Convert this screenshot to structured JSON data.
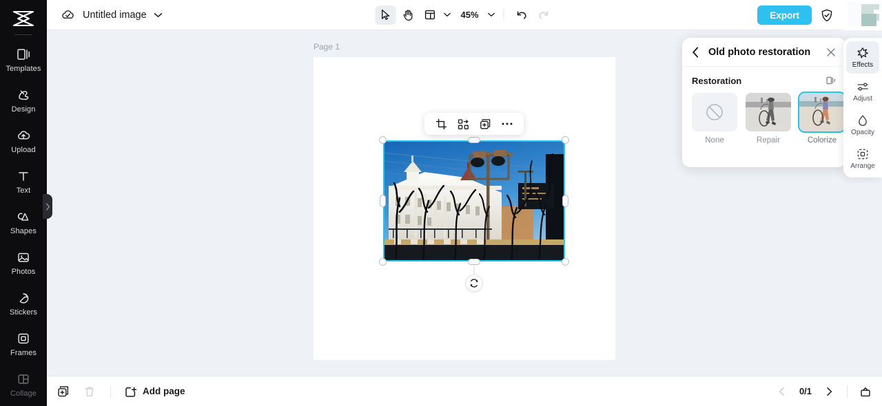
{
  "sidebar": {
    "logo_name": "capcut-logo",
    "items": [
      {
        "label": "Templates",
        "icon": "templates-icon",
        "dim": false
      },
      {
        "label": "Design",
        "icon": "design-icon",
        "dim": false
      },
      {
        "label": "Upload",
        "icon": "upload-icon",
        "dim": false
      },
      {
        "label": "Text",
        "icon": "text-icon",
        "dim": false
      },
      {
        "label": "Shapes",
        "icon": "shapes-icon",
        "dim": false
      },
      {
        "label": "Photos",
        "icon": "photos-icon",
        "dim": false
      },
      {
        "label": "Stickers",
        "icon": "stickers-icon",
        "dim": false
      },
      {
        "label": "Frames",
        "icon": "frames-icon",
        "dim": false
      },
      {
        "label": "Collage",
        "icon": "collage-icon",
        "dim": true
      }
    ]
  },
  "topbar": {
    "cloud_icon": "cloud-sync-icon",
    "title": "Untitled image",
    "title_caret": "chevron-down-icon",
    "tools": [
      {
        "name": "select-tool",
        "icon": "cursor-arrow-icon",
        "active": true
      },
      {
        "name": "hand-tool",
        "icon": "hand-icon",
        "active": false
      },
      {
        "name": "layout-tool",
        "icon": "layout-grid-icon",
        "active": false
      }
    ],
    "zoom_level": "45%",
    "undo_label": "undo-icon",
    "redo_label": "redo-icon",
    "export_label": "Export",
    "shield_icon": "shield-check-icon",
    "avatar": "user-avatar"
  },
  "canvas": {
    "page_label": "Page 1",
    "context_toolbar": [
      {
        "name": "crop-button",
        "icon": "crop-icon"
      },
      {
        "name": "replace-button",
        "icon": "replace-image-icon"
      },
      {
        "name": "duplicate-button",
        "icon": "duplicate-icon"
      },
      {
        "name": "more-button",
        "icon": "ellipsis-icon"
      }
    ],
    "selection_color": "#22c7ef",
    "rotate_handle": "rotate-icon"
  },
  "panel": {
    "back_icon": "chevron-left-icon",
    "title": "Old photo restoration",
    "close_icon": "close-icon",
    "section_title": "Restoration",
    "compare_icon": "before-after-compare-icon",
    "options": [
      {
        "label": "None",
        "selected": false,
        "kind": "none"
      },
      {
        "label": "Repair",
        "selected": false,
        "kind": "grayscale"
      },
      {
        "label": "Colorize",
        "selected": true,
        "kind": "color"
      }
    ]
  },
  "right_rail": {
    "items": [
      {
        "label": "Effects",
        "icon": "sparkle-icon",
        "active": true
      },
      {
        "label": "Adjust",
        "icon": "sliders-icon",
        "active": false
      },
      {
        "label": "Opacity",
        "icon": "droplet-icon",
        "active": false
      },
      {
        "label": "Arrange",
        "icon": "arrange-icon",
        "active": false
      }
    ]
  },
  "bottombar": {
    "duplicate_page_icon": "duplicate-page-icon",
    "delete_page_icon": "trash-icon",
    "add_page_icon": "add-page-icon",
    "add_page_label": "Add page",
    "prev_icon": "chevron-left-icon",
    "page_count": "0/1",
    "next_icon": "chevron-right-icon",
    "present_icon": "present-icon"
  }
}
